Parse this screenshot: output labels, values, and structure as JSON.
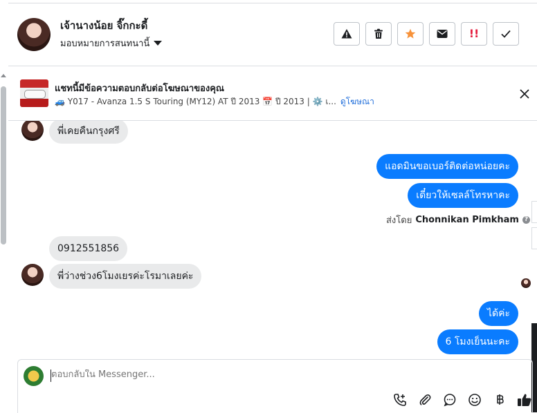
{
  "header": {
    "contact_name": "เจ้านางน้อย จิ๊กกะดี้",
    "assign_label": "มอบหมายการสนทนานี้",
    "actions": [
      "spam-icon",
      "trash-icon",
      "star-icon",
      "envelope-icon",
      "follow-up-icon",
      "check-icon"
    ],
    "star_color": "#f7923a",
    "follow_up_color": "#e41e3f",
    "follow_up_text": "!!"
  },
  "ad_banner": {
    "title": "แชทนี้มีข้อความตอบกลับต่อโฆษณาของคุณ",
    "subtitle": "🚙 Y017 - Avanza 1.5 S Touring (MY12) AT ปี 2013 📅 ปี 2013 | ⚙️ เ...",
    "link": "ดูโฆษณา"
  },
  "messages": {
    "m1": "พี่เคยคืนกรุงศรี",
    "m2": "แอดมินขอเบอร์ติดต่อหน่อยคะ",
    "m3": "เดี๋ยวให้เซลล์โทรหาคะ",
    "sent_by_prefix": "ส่งโดย",
    "sent_by_name": "Chonnikan Pimkham",
    "m4": "0912551856",
    "m5": "พี่ว่างช่วง6โมงเยรค่ะโรมาเลยค่ะ",
    "m6": "ได้ค่ะ",
    "m7": "6 โมงเย็นนะคะ"
  },
  "composer": {
    "placeholder": "ตอบกลับใน Messenger...",
    "tools": [
      "call-add-icon",
      "attachment-icon",
      "saved-reply-icon",
      "emoji-icon",
      "payment-icon",
      "thumbs-up-icon"
    ],
    "accent": "#0a7cff"
  }
}
